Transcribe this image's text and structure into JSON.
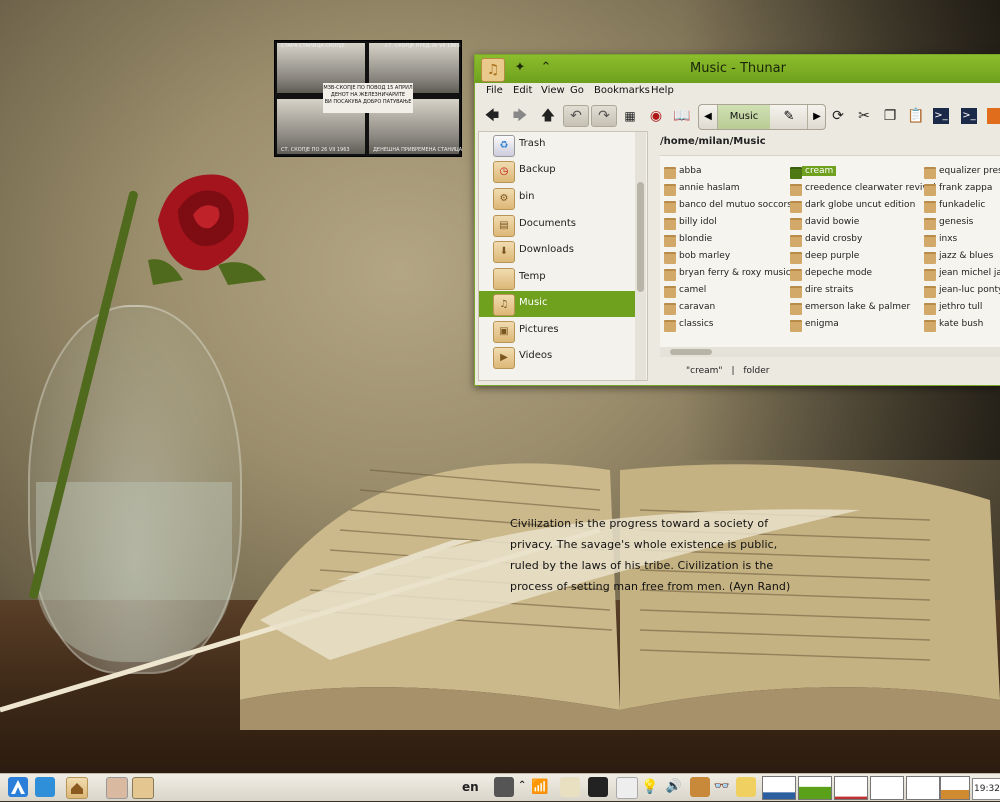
{
  "desktop": {
    "photo": {
      "top_left_label": "СТАРА СТАНИЦА СКОПЈЕ",
      "top_right_label": "СТ. СКОПЈЕ ПРЕД 26 VII 1963",
      "center_lines": [
        "МЗВ-СКОПЈЕ ПО ПОВОД 15 АПРИЛ",
        "ДЕНОТ НА ЖЕЛЕЗНИЧАРИТЕ",
        "ВИ ПОСАКУВА ДОБРО ПАТУВАЊЕ"
      ],
      "bottom_left_label": "СТ. СКОПЈЕ ПО 26 VII 1963",
      "bottom_right_label": "ДЕНЕШНА ПРИВРЕМЕНА СТАНИЦА"
    },
    "quote": "Civilization is the progress toward a society of privacy. The savage's whole existence is public, ruled by the laws of his tribe. Civilization is the process of setting man free from men. (Ayn Rand)"
  },
  "window": {
    "title": "Music - Thunar",
    "menu": [
      "File",
      "Edit",
      "View",
      "Go",
      "Bookmarks",
      "Help"
    ],
    "pathbar": {
      "current": "Music"
    },
    "location": "/home/milan/Music",
    "sidebar": [
      {
        "label": "Trash",
        "icon": "trash-icon"
      },
      {
        "label": "Backup",
        "icon": "backup-folder-icon"
      },
      {
        "label": "bin",
        "icon": "bin-folder-icon"
      },
      {
        "label": "Documents",
        "icon": "documents-folder-icon"
      },
      {
        "label": "Downloads",
        "icon": "downloads-folder-icon"
      },
      {
        "label": "Temp",
        "icon": "folder-icon"
      },
      {
        "label": "Music",
        "icon": "music-folder-icon",
        "selected": true
      },
      {
        "label": "Pictures",
        "icon": "pictures-folder-icon"
      },
      {
        "label": "Videos",
        "icon": "videos-folder-icon"
      }
    ],
    "files": {
      "col1": [
        "abba",
        "annie haslam",
        "banco del mutuo soccorso",
        "billy idol",
        "blondie",
        "bob marley",
        "bryan ferry & roxy music",
        "camel",
        "caravan",
        "classics"
      ],
      "col2": [
        "cream",
        "creedence clearwater revival",
        "dark globe uncut edition",
        "david bowie",
        "david crosby",
        "deep purple",
        "depeche mode",
        "dire straits",
        "emerson lake & palmer",
        "enigma"
      ],
      "col3": [
        "equalizer presets",
        "frank zappa",
        "funkadelic",
        "genesis",
        "inxs",
        "jazz & blues",
        "jean michel jarre",
        "jean-luc ponty",
        "jethro tull",
        "kate bush"
      ]
    },
    "selected_file": "cream",
    "status": {
      "name": "\"cream\"",
      "sep": "|",
      "type": "folder"
    }
  },
  "taskbar": {
    "lang": "en",
    "clock": "19:32"
  },
  "colors": {
    "accent": "#6fa01e",
    "titlebar": "#8cbd2c"
  }
}
